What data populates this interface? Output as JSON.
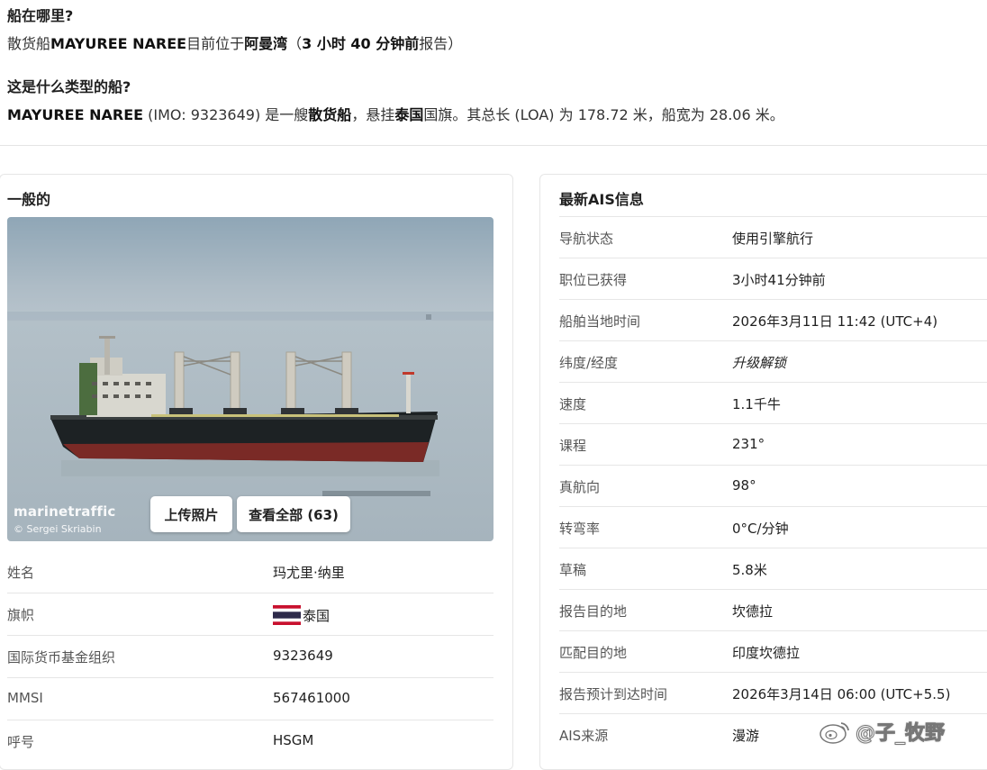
{
  "where": {
    "title": "船在哪里?",
    "line": {
      "prefix": "散货船",
      "ship_name": "MAYUREE NAREE",
      "mid": "目前位于",
      "location": "阿曼湾",
      "paren_open": "（",
      "age": "3 小时 40 分钟前",
      "suffix": "报告）"
    }
  },
  "type": {
    "title": "这是什么类型的船?",
    "line": {
      "ship_name": "MAYUREE NAREE",
      "imo": " (IMO: 9323649) 是一艘",
      "ship_type": "散货船",
      "flag_pre": "，悬挂",
      "flag": "泰国",
      "rest": "国旗。其总长 (LOA) 为 178.72 米，船宽为 28.06 米。"
    }
  },
  "general": {
    "title": "一般的",
    "watermark": "marinetraffic",
    "credit": "© Sergei Skriabin",
    "upload_button": "上传照片",
    "view_all_button": "查看全部 (63)",
    "rows": [
      {
        "label": "姓名",
        "value": "玛尤里·纳里"
      },
      {
        "label": "旗帜",
        "value": "泰国"
      },
      {
        "label": "国际货币基金组织",
        "value": "9323649"
      },
      {
        "label": "MMSI",
        "value": "567461000"
      },
      {
        "label": "呼号",
        "value": "HSGM"
      }
    ]
  },
  "ais": {
    "title": "最新AIS信息",
    "rows": [
      {
        "label": "导航状态",
        "value": "使用引擎航行"
      },
      {
        "label": "职位已获得",
        "value": "3小时41分钟前"
      },
      {
        "label": "船舶当地时间",
        "value": "2026年3月11日 11:42 (UTC+4)"
      },
      {
        "label": "纬度/经度",
        "value": "升级解锁"
      },
      {
        "label": "速度",
        "value": "1.1千牛"
      },
      {
        "label": "课程",
        "value": "231°"
      },
      {
        "label": "真航向",
        "value": "98°"
      },
      {
        "label": "转弯率",
        "value": "0°C/分钟"
      },
      {
        "label": "草稿",
        "value": "5.8米"
      },
      {
        "label": "报告目的地",
        "value": "坎德拉"
      },
      {
        "label": "匹配目的地",
        "value": "印度坎德拉"
      },
      {
        "label": "报告预计到达时间",
        "value": "2026年3月14日 06:00 (UTC+5.5)"
      },
      {
        "label": "AIS来源",
        "value": "漫游"
      }
    ]
  },
  "weibo_watermark": "@子_牧野",
  "colors": {
    "thai_red": "#c8102e",
    "thai_blue": "#2d2a4a",
    "hull_red": "#7a2a26",
    "hull_black": "#1d2224"
  }
}
